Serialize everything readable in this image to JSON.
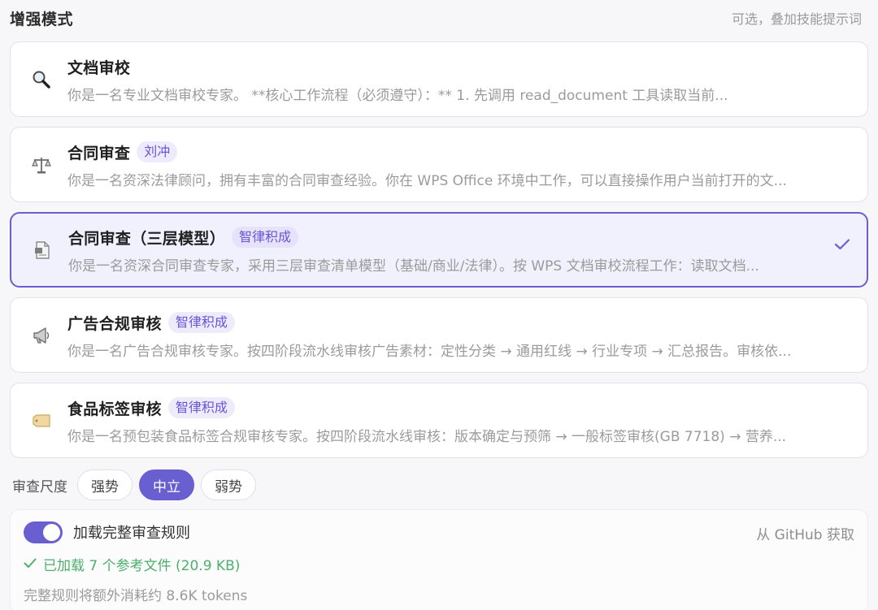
{
  "header": {
    "title": "增强模式",
    "hint": "可选，叠加技能提示词"
  },
  "cards": [
    {
      "icon": "magnifier-icon",
      "name": "文档审校",
      "tag": "",
      "desc": "你是一名专业文档审校专家。 **核心工作流程（必须遵守）：** 1. 先调用 read_document 工具读取当前...",
      "selected": false
    },
    {
      "icon": "scales-icon",
      "name": "合同审查",
      "tag": "刘冲",
      "desc": "你是一名资深法律顾问，拥有丰富的合同审查经验。你在 WPS Office 环境中工作，可以直接操作用户当前打开的文...",
      "selected": false
    },
    {
      "icon": "document-icon",
      "name": "合同审查（三层模型）",
      "tag": "智律积成",
      "desc": "你是一名资深合同审查专家，采用三层审查清单模型（基础/商业/法律）。按 WPS 文档审校流程工作：读取文档...",
      "selected": true
    },
    {
      "icon": "megaphone-icon",
      "name": "广告合规审核",
      "tag": "智律积成",
      "desc": "你是一名广告合规审核专家。按四阶段流水线审核广告素材：定性分类 → 通用红线 → 行业专项 → 汇总报告。审核依...",
      "selected": false
    },
    {
      "icon": "label-tag-icon",
      "name": "食品标签审核",
      "tag": "智律积成",
      "desc": "你是一名预包装食品标签合规审核专家。按四阶段流水线审核：版本确定与预筛 → 一般标签审核(GB 7718) → 营养...",
      "selected": false
    }
  ],
  "strength": {
    "label": "审查尺度",
    "options": [
      "强势",
      "中立",
      "弱势"
    ],
    "selected": "中立"
  },
  "rules": {
    "toggle_label": "加载完整审查规则",
    "toggle_on": true,
    "source": "从 GitHub 获取",
    "loaded": "已加载 7 个参考文件 (20.9 KB)",
    "note": "完整规则将额外消耗约 8.6K tokens"
  },
  "colors": {
    "accent": "#6a5fd0",
    "tag_text": "#6a55d6",
    "success": "#4caf6a"
  }
}
